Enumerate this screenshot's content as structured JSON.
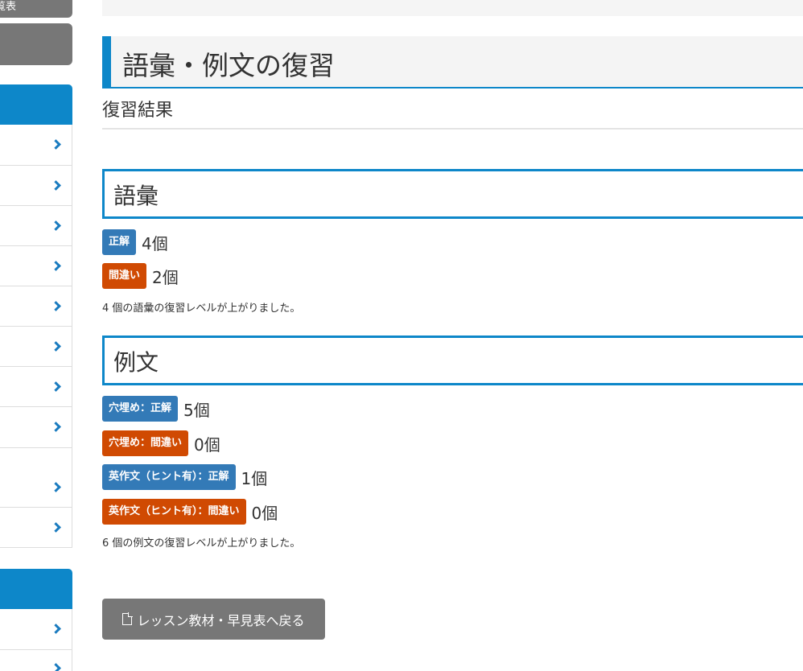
{
  "sidebar": {
    "top_button_label": "覧表",
    "list1_count": 10,
    "list2_count": 2
  },
  "page": {
    "title": "語彙・例文の復習",
    "subtitle": "復習結果"
  },
  "vocab": {
    "heading": "語彙",
    "results": [
      {
        "label": "正解",
        "count": "4個",
        "color": "#337ab7"
      },
      {
        "label": "間違い",
        "count": "2個",
        "color": "#d04a02"
      }
    ],
    "note": "4 個の語彙の復習レベルが上がりました。"
  },
  "sentences": {
    "heading": "例文",
    "results": [
      {
        "label": "穴埋め：正解",
        "count": "5個",
        "color": "#337ab7"
      },
      {
        "label": "穴埋め：間違い",
        "count": "0個",
        "color": "#d04a02"
      },
      {
        "label": "英作文（ヒント有）：正解",
        "count": "1個",
        "color": "#337ab7"
      },
      {
        "label": "英作文（ヒント有）：間違い",
        "count": "0個",
        "color": "#d04a02"
      }
    ],
    "note": "6 個の例文の復習レベルが上がりました。"
  },
  "back_button": {
    "label": "レッスン教材・早見表へ戻る",
    "icon": "file-icon"
  },
  "colors": {
    "accent": "#0d87c9",
    "success": "#337ab7",
    "danger": "#d04a02",
    "neutral": "#777777"
  }
}
